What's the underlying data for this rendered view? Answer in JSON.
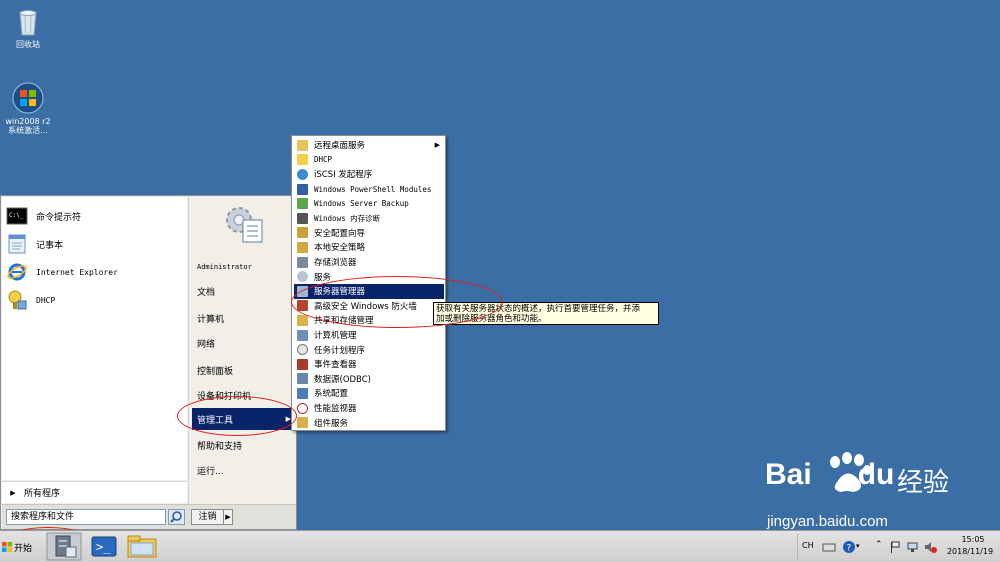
{
  "colors": {
    "desktop": "#3a6ea5",
    "selection": "#0a246a",
    "annotation": "#e0201c",
    "tooltip_bg": "#ffffe1"
  },
  "desktop": {
    "icons": [
      {
        "name": "回收站",
        "icon": "recycle-bin-icon"
      },
      {
        "name": "win2008 r2",
        "sub": "系统激活...",
        "icon": "windows-activator-icon"
      }
    ]
  },
  "start_menu": {
    "pinned": [
      {
        "label": "命令提示符",
        "icon": "cmd-icon"
      },
      {
        "label": "记事本",
        "icon": "notepad-icon"
      },
      {
        "label": "Internet Explorer",
        "icon": "ie-icon"
      },
      {
        "label": "DHCP",
        "icon": "dhcp-icon"
      }
    ],
    "all_programs": "所有程序",
    "search_placeholder": "搜索程序和文件",
    "logoff": "注销",
    "right_items": [
      "Administrator",
      "文档",
      "计算机",
      "网络",
      "控制面板",
      "设备和打印机",
      "管理工具",
      "帮助和支持",
      "运行..."
    ]
  },
  "admin_tools_menu": {
    "items": [
      {
        "label": "远程桌面服务",
        "has_submenu": true
      },
      {
        "label": "DHCP"
      },
      {
        "label": "iSCSI 发起程序"
      },
      {
        "label": "Windows PowerShell Modules"
      },
      {
        "label": "Windows Server Backup"
      },
      {
        "label": "Windows 内存诊断"
      },
      {
        "label": "安全配置向导"
      },
      {
        "label": "本地安全策略"
      },
      {
        "label": "存储浏览器"
      },
      {
        "label": "服务"
      },
      {
        "label": "服务器管理器",
        "selected": true
      },
      {
        "label": "高级安全 Windows 防火墙"
      },
      {
        "label": "共享和存储管理"
      },
      {
        "label": "计算机管理"
      },
      {
        "label": "任务计划程序"
      },
      {
        "label": "事件查看器"
      },
      {
        "label": "数据源(ODBC)"
      },
      {
        "label": "系统配置"
      },
      {
        "label": "性能监视器"
      },
      {
        "label": "组件服务"
      }
    ]
  },
  "tooltip": {
    "line1": "获取有关服务器状态的概述，执行首要管理任务，并添",
    "line2": "加或删除服务器角色和功能。"
  },
  "taskbar": {
    "start_label": "开始",
    "language": "CH",
    "time": "15:05",
    "date": "2018/11/19"
  },
  "watermark": {
    "brand": "Bai",
    "brand2": "du",
    "cn": "经验",
    "url": "jingyan.baidu.com"
  }
}
